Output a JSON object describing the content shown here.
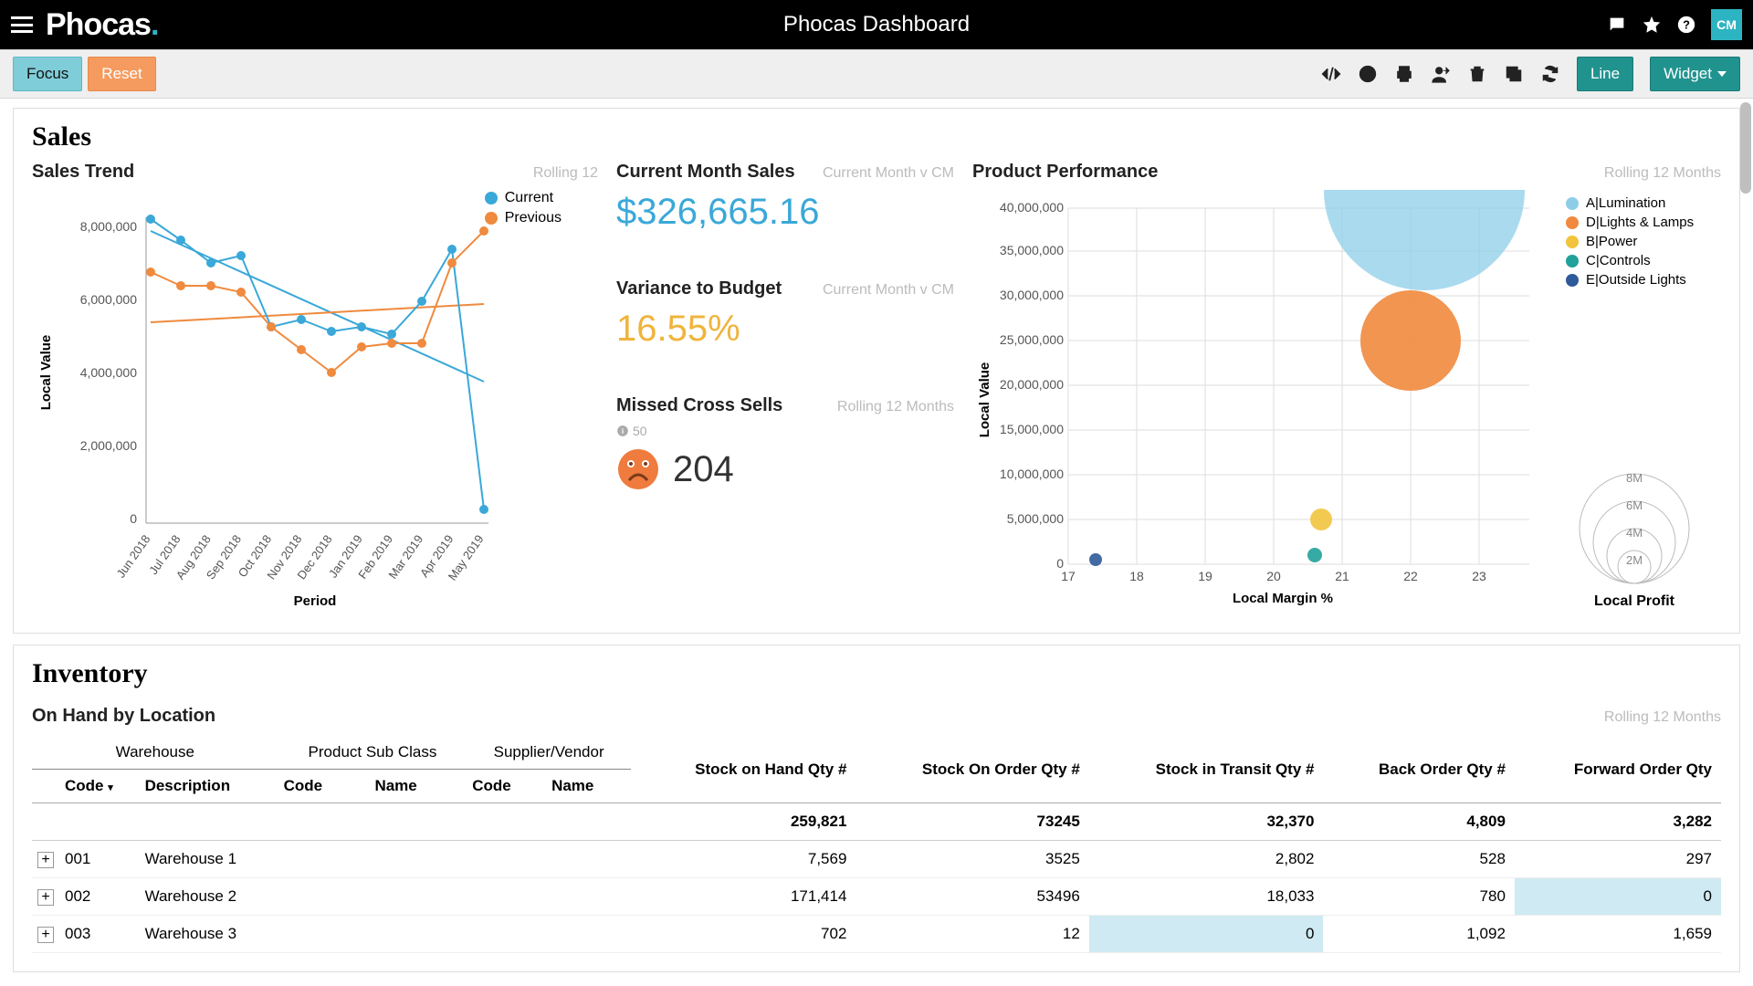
{
  "app": {
    "title": "Phocas Dashboard",
    "logo_text": "Phocas",
    "user_initials": "CM"
  },
  "toolbar": {
    "focus": "Focus",
    "reset": "Reset",
    "line": "Line",
    "widget": "Widget"
  },
  "sales": {
    "section": "Sales",
    "trend": {
      "title": "Sales Trend",
      "subtitle": "Rolling 12",
      "legend": {
        "current": "Current",
        "previous": "Previous"
      },
      "ylabel": "Local Value",
      "xlabel": "Period",
      "yticks": [
        "0",
        "2,000,000",
        "4,000,000",
        "6,000,000",
        "8,000,000"
      ]
    },
    "kpi": {
      "cms_title": "Current Month Sales",
      "cms_sub": "Current Month v CM",
      "cms_value": "$326,665.16",
      "var_title": "Variance to Budget",
      "var_sub": "Current Month v CM",
      "var_value": "16.55%",
      "miss_title": "Missed Cross Sells",
      "miss_sub": "Rolling 12 Months",
      "miss_threshold": "50",
      "miss_value": "204"
    },
    "perf": {
      "title": "Product Performance",
      "subtitle": "Rolling 12 Months",
      "ylabel": "Local Value",
      "xlabel": "Local Margin %",
      "yticks": [
        "0",
        "5,000,000",
        "10,000,000",
        "15,000,000",
        "20,000,000",
        "25,000,000",
        "30,000,000",
        "35,000,000",
        "40,000,000"
      ],
      "xticks": [
        "17",
        "18",
        "19",
        "20",
        "21",
        "22",
        "23"
      ],
      "legend": [
        "A|Lumination",
        "D|Lights & Lamps",
        "B|Power",
        "C|Controls",
        "E|Outside Lights"
      ],
      "legend_colors": [
        "#8ecde8",
        "#ef8a3e",
        "#f2c43e",
        "#20a19a",
        "#2f5a99"
      ],
      "size_legend": [
        "8M",
        "6M",
        "4M",
        "2M"
      ],
      "size_caption": "Local Profit"
    }
  },
  "inventory": {
    "section": "Inventory",
    "title": "On Hand by Location",
    "subtitle": "Rolling 12 Months",
    "group_headers": [
      "Warehouse",
      "Product Sub Class",
      "Supplier/Vendor"
    ],
    "sub_headers": [
      "Code",
      "Description",
      "Code",
      "Name",
      "Code",
      "Name"
    ],
    "metric_headers": [
      "Stock on Hand Qty #",
      "Stock On Order Qty #",
      "Stock in Transit Qty #",
      "Back Order Qty #",
      "Forward Order Qty"
    ],
    "totals": [
      "259,821",
      "73245",
      "32,370",
      "4,809",
      "3,282"
    ],
    "rows": [
      {
        "code": "001",
        "desc": "Warehouse 1",
        "v": [
          "7,569",
          "3525",
          "2,802",
          "528",
          "297"
        ],
        "hl": []
      },
      {
        "code": "002",
        "desc": "Warehouse 2",
        "v": [
          "171,414",
          "53496",
          "18,033",
          "780",
          "0"
        ],
        "hl": [
          4
        ]
      },
      {
        "code": "003",
        "desc": "Warehouse 3",
        "v": [
          "702",
          "12",
          "0",
          "1,092",
          "1,659"
        ],
        "hl": [
          2
        ]
      }
    ]
  },
  "chart_data": [
    {
      "type": "line",
      "title": "Sales Trend",
      "xlabel": "Period",
      "ylabel": "Local Value",
      "categories": [
        "Jun 2018",
        "Jul 2018",
        "Aug 2018",
        "Sep 2018",
        "Oct 2018",
        "Nov 2018",
        "Dec 2018",
        "Jan 2019",
        "Feb 2019",
        "Mar 2019",
        "Apr 2019",
        "May 2019"
      ],
      "series": [
        {
          "name": "Current",
          "color": "#3aa8d8",
          "values": [
            8200000,
            7600000,
            7000000,
            7200000,
            5200000,
            5400000,
            5100000,
            5200000,
            5000000,
            5900000,
            7400000,
            400000
          ]
        },
        {
          "name": "Previous",
          "color": "#ef8a3e",
          "values": [
            6800000,
            6400000,
            6400000,
            6200000,
            5200000,
            4600000,
            4000000,
            4700000,
            4800000,
            4800000,
            7000000,
            7700000
          ]
        }
      ],
      "trendlines": [
        {
          "name": "Current trend",
          "color": "#3aa8d8",
          "start": 7700000,
          "end": 3700000
        },
        {
          "name": "Previous trend",
          "color": "#ef8a3e",
          "start": 5400000,
          "end": 5900000
        }
      ],
      "ylim": [
        0,
        8500000
      ]
    },
    {
      "type": "scatter",
      "title": "Product Performance",
      "xlabel": "Local Margin %",
      "ylabel": "Local Value",
      "xlim": [
        17,
        23.5
      ],
      "ylim": [
        0,
        42000000
      ],
      "series": [
        {
          "name": "A|Lumination",
          "color": "#8ecde8",
          "x": 22.2,
          "y": 42000000,
          "size": 9000000
        },
        {
          "name": "D|Lights & Lamps",
          "color": "#ef8a3e",
          "x": 22.0,
          "y": 25000000,
          "size": 5000000
        },
        {
          "name": "B|Power",
          "color": "#f2c43e",
          "x": 20.7,
          "y": 5000000,
          "size": 1000000
        },
        {
          "name": "C|Controls",
          "color": "#20a19a",
          "x": 20.6,
          "y": 1000000,
          "size": 400000
        },
        {
          "name": "E|Outside Lights",
          "color": "#2f5a99",
          "x": 17.4,
          "y": 500000,
          "size": 300000
        }
      ],
      "size_scale_label": "Local Profit",
      "size_scale": [
        "2M",
        "4M",
        "6M",
        "8M"
      ]
    }
  ]
}
